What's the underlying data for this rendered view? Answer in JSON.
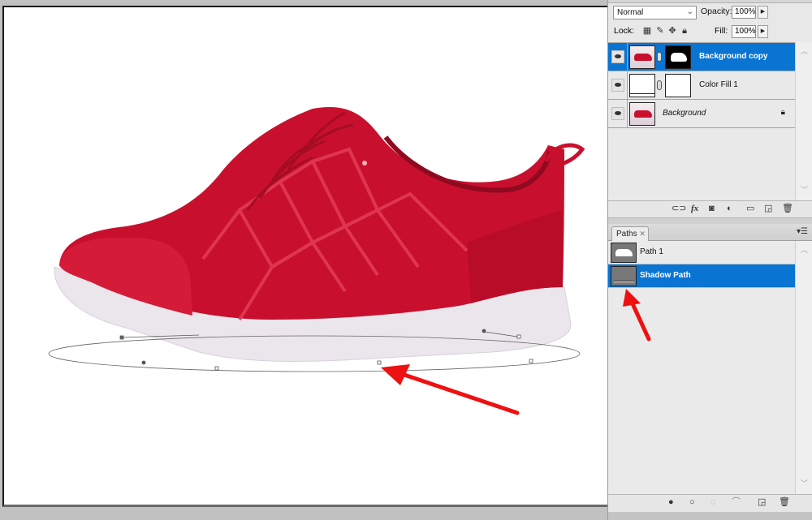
{
  "layers_panel": {
    "blend_mode": "Normal",
    "opacity_label": "Opacity:",
    "opacity_value": "100%",
    "lock_label": "Lock:",
    "fill_label": "Fill:",
    "fill_value": "100%",
    "layers": [
      {
        "name": "Background copy",
        "selected": true,
        "visible": true,
        "has_mask": true
      },
      {
        "name": "Color Fill 1",
        "selected": false,
        "visible": true,
        "has_mask": true
      },
      {
        "name": "Background",
        "selected": false,
        "visible": true,
        "locked": true
      }
    ],
    "footer_icons": [
      "link-layers-icon",
      "fx-icon",
      "add-mask-icon",
      "adjustment-layer-icon",
      "new-group-icon",
      "new-layer-icon",
      "delete-icon"
    ]
  },
  "paths_panel": {
    "tab_label": "Paths",
    "tab_close": "✕",
    "paths": [
      {
        "name": "Path 1",
        "selected": false
      },
      {
        "name": "Shadow Path",
        "selected": true
      }
    ],
    "footer_icons": [
      "fill-path-icon",
      "stroke-path-icon",
      "load-selection-icon",
      "make-work-path-icon",
      "new-path-icon",
      "delete-path-icon"
    ]
  },
  "canvas": {
    "subject": "red running shoe",
    "colors": {
      "shoe": "#c8102e",
      "sole": "#ece8ee",
      "path": "#555555",
      "annotation_arrow": "#ee1111",
      "selection": "#0a74d3"
    }
  }
}
